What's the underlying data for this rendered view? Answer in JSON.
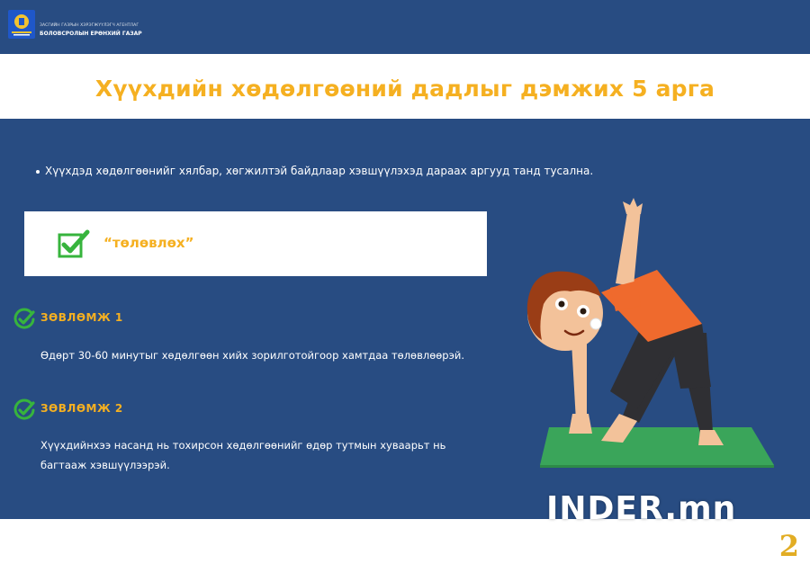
{
  "header": {
    "agency_line1": "ЗАСГИЙН ГАЗРЫН ХЭРЭГЖҮҮЛЭГЧ АГЕНТЛАГ",
    "agency_line2": "БОЛОВСРОЛЫН ЕРӨНХИЙ ГАЗАР"
  },
  "title": "Хүүхдийн хөдөлгөөний дадлыг дэмжих 5 арга",
  "intro": "Хүүхдэд хөдөлгөөнийг хялбар, хөгжилтэй байдлаар хэвшүүлэхэд дараах аргууд танд тусална.",
  "plan": {
    "label": "“төлөвлөх”"
  },
  "tips": [
    {
      "title": "ЗӨВЛӨМЖ 1",
      "text": "Өдөрт 30-60 минутыг хөдөлгөөн хийх зорилготойгоор хамтдаа төлөвлөөрэй."
    },
    {
      "title": "ЗӨВЛӨМЖ 2",
      "text_line1": "Хүүхдийнхээ насанд нь тохирсон хөдөлгөөнийг өдөр тутмын хуваарьт нь",
      "text_line2": "багтааж хэвшүүлээрэй."
    }
  ],
  "watermark": "INDER.mn",
  "page_number": "2",
  "colors": {
    "navy": "#284c82",
    "accent_yellow": "#f5b021",
    "check_green": "#37b43d",
    "mat_green": "#3aa55a"
  }
}
